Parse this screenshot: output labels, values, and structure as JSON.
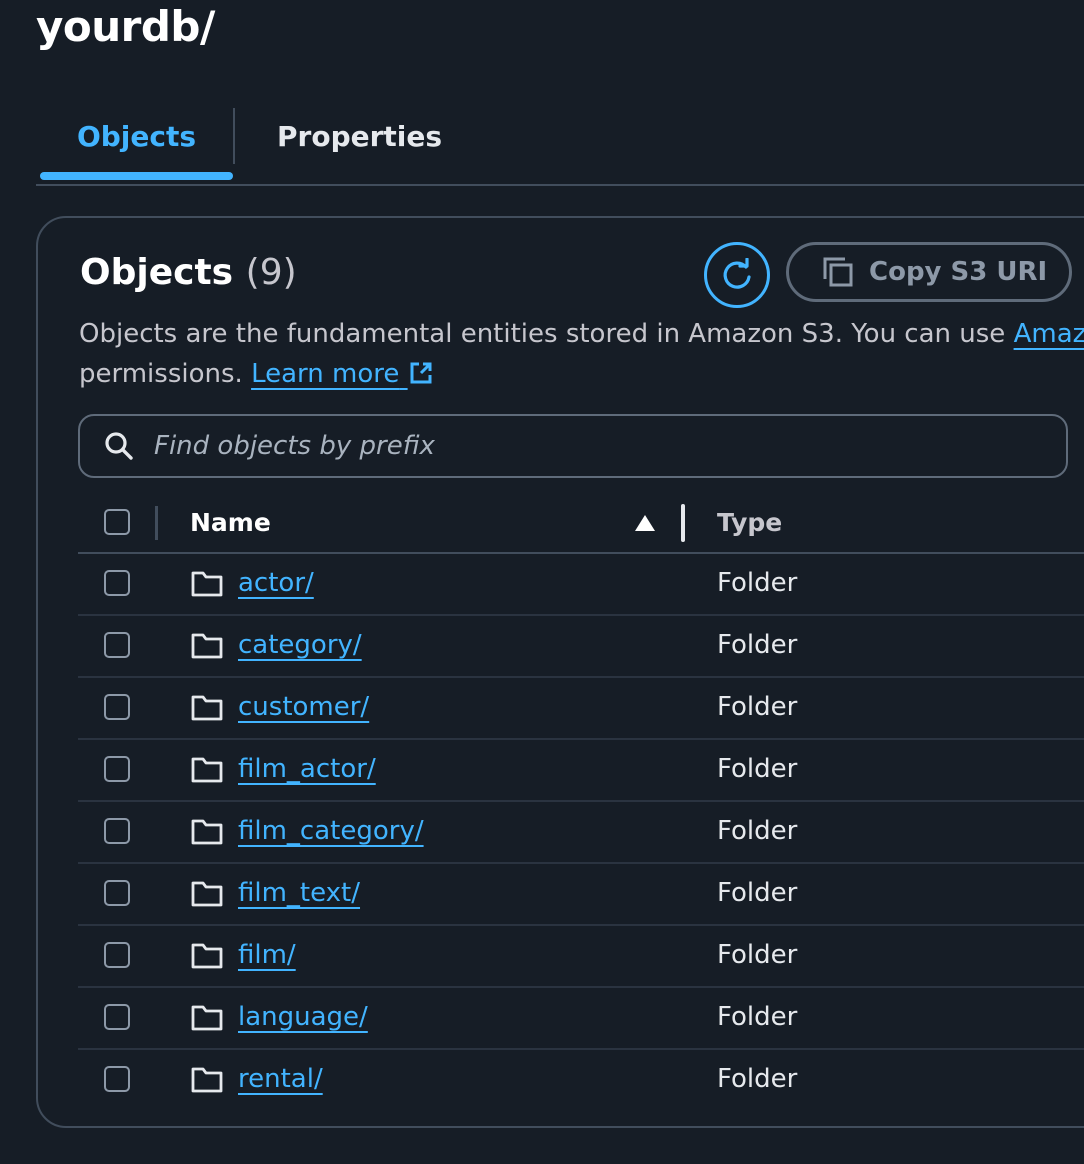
{
  "page": {
    "title": "yourdb/"
  },
  "tabs": [
    {
      "label": "Objects",
      "active": true
    },
    {
      "label": "Properties",
      "active": false
    }
  ],
  "panel": {
    "title": "Objects",
    "count": "(9)",
    "refresh_icon": "refresh-icon",
    "copy_button_label": "Copy S3 URI",
    "copy_icon": "copy-icon",
    "description_text": "Objects are the fundamental entities stored in Amazon S3. You can use ",
    "description_link": "Amazon",
    "description_line2": "permissions. ",
    "learn_more_label": "Learn more",
    "external_link_icon": "external-link-icon"
  },
  "search": {
    "placeholder": "Find objects by prefix",
    "value": "",
    "icon": "search-icon"
  },
  "table": {
    "columns": [
      "Name",
      "Type"
    ],
    "sort_column": "Name",
    "sort_direction": "ascending",
    "rows": [
      {
        "name": "actor/",
        "type": "Folder"
      },
      {
        "name": "category/",
        "type": "Folder"
      },
      {
        "name": "customer/",
        "type": "Folder"
      },
      {
        "name": "film_actor/",
        "type": "Folder"
      },
      {
        "name": "film_category/",
        "type": "Folder"
      },
      {
        "name": "film_text/",
        "type": "Folder"
      },
      {
        "name": "film/",
        "type": "Folder"
      },
      {
        "name": "language/",
        "type": "Folder"
      },
      {
        "name": "rental/",
        "type": "Folder"
      }
    ]
  },
  "colors": {
    "background": "#161d26",
    "accent": "#42b4ff",
    "border": "#414d5c",
    "text": "#e6e9ed"
  }
}
